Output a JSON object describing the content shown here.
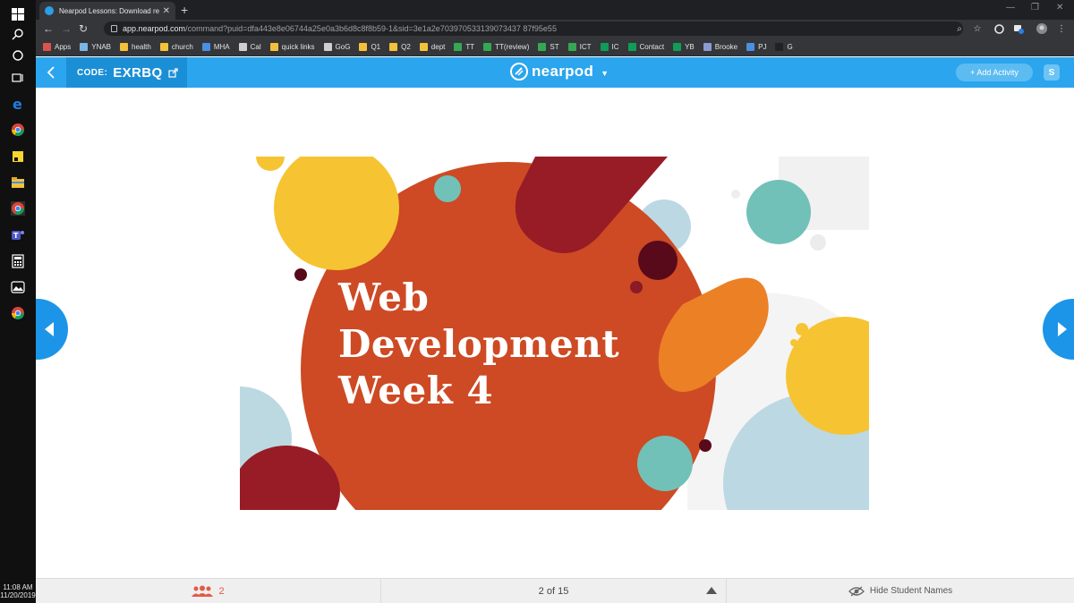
{
  "taskbar": {
    "icons": [
      "windows-start-icon",
      "search-icon",
      "cortana-icon",
      "task-view-icon",
      "edge-icon",
      "chrome-icon",
      "sticky-notes-icon",
      "file-explorer-icon",
      "chrome-canary-icon",
      "teams-icon",
      "calculator-icon",
      "photos-icon",
      "chrome-icon"
    ],
    "time": "11:08 AM",
    "date": "11/20/2019"
  },
  "browser": {
    "tab_title": "Nearpod Lessons: Download rea",
    "url_host": "app.nearpod.com",
    "url_path": "/command?puid=dfa443e8e06744a25e0a3b6d8c8f8b59-1&sid=3e1a2e703970533139073437 87f95e55",
    "bookmarks": [
      {
        "label": "Apps",
        "color": "#d9534f"
      },
      {
        "label": "YNAB",
        "color": "#7ab6e6"
      },
      {
        "label": "health",
        "color": "#f3c13a"
      },
      {
        "label": "church",
        "color": "#f3c13a"
      },
      {
        "label": "MHA",
        "color": "#4a8fe0"
      },
      {
        "label": "Cal",
        "color": "#cfcfcf"
      },
      {
        "label": "quick links",
        "color": "#f3c13a"
      },
      {
        "label": "GoG",
        "color": "#cfcfcf"
      },
      {
        "label": "Q1",
        "color": "#f3c13a"
      },
      {
        "label": "Q2",
        "color": "#f3c13a"
      },
      {
        "label": "dept",
        "color": "#f3c13a"
      },
      {
        "label": "TT",
        "color": "#34a853"
      },
      {
        "label": "TT(review)",
        "color": "#34a853"
      },
      {
        "label": "ST",
        "color": "#34a853"
      },
      {
        "label": "ICT",
        "color": "#34a853"
      },
      {
        "label": "IC",
        "color": "#0f9d58"
      },
      {
        "label": "Contact",
        "color": "#0f9d58"
      },
      {
        "label": "YB",
        "color": "#0f9d58"
      },
      {
        "label": "Brooke",
        "color": "#8a9bd0"
      },
      {
        "label": "PJ",
        "color": "#4a8fe0"
      },
      {
        "label": "G",
        "color": "#222222"
      }
    ]
  },
  "nearpod": {
    "code_label": "CODE:",
    "code_value": "EXRBQ",
    "logo_text": "nearpod",
    "add_activity": "+ Add Activity",
    "profile_initial": "S",
    "accent": "#2aa5ee"
  },
  "slide": {
    "title": "Web\nDevelopment\nWeek 4"
  },
  "footer": {
    "student_count": "2",
    "page_indicator": "2 of 15",
    "hide_names": "Hide Student Names"
  }
}
